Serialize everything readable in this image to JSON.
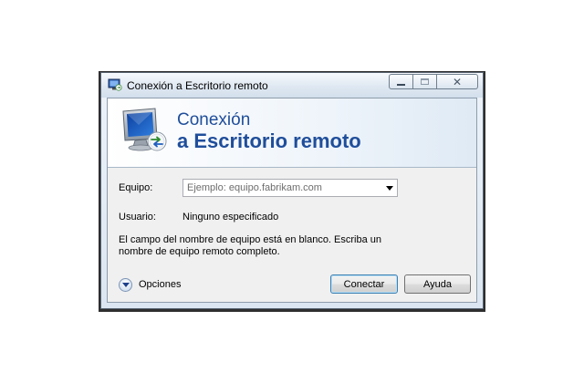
{
  "window": {
    "title": "Conexión a Escritorio remoto",
    "caption_buttons": {
      "minimize": "minimize-icon",
      "maximize": "maximize-icon",
      "close": "✕"
    }
  },
  "banner": {
    "line1": "Conexión",
    "line2": "a Escritorio remoto",
    "icon": "remote-desktop-monitor-icon"
  },
  "form": {
    "computer_label": "Equipo:",
    "computer_placeholder": "Ejemplo: equipo.fabrikam.com",
    "computer_value": "",
    "user_label": "Usuario:",
    "user_value": "Ninguno especificado",
    "message": "El campo del nombre de equipo está en blanco. Escriba un nombre de equipo remoto completo."
  },
  "footer": {
    "options_label": "Opciones",
    "connect_label": "Conectar",
    "help_label": "Ayuda"
  },
  "colors": {
    "banner_text": "#1f4e9b",
    "titlebar": "#dfe8f2",
    "client_bg": "#f0f0f0",
    "default_button_border": "#3c7fb1"
  }
}
